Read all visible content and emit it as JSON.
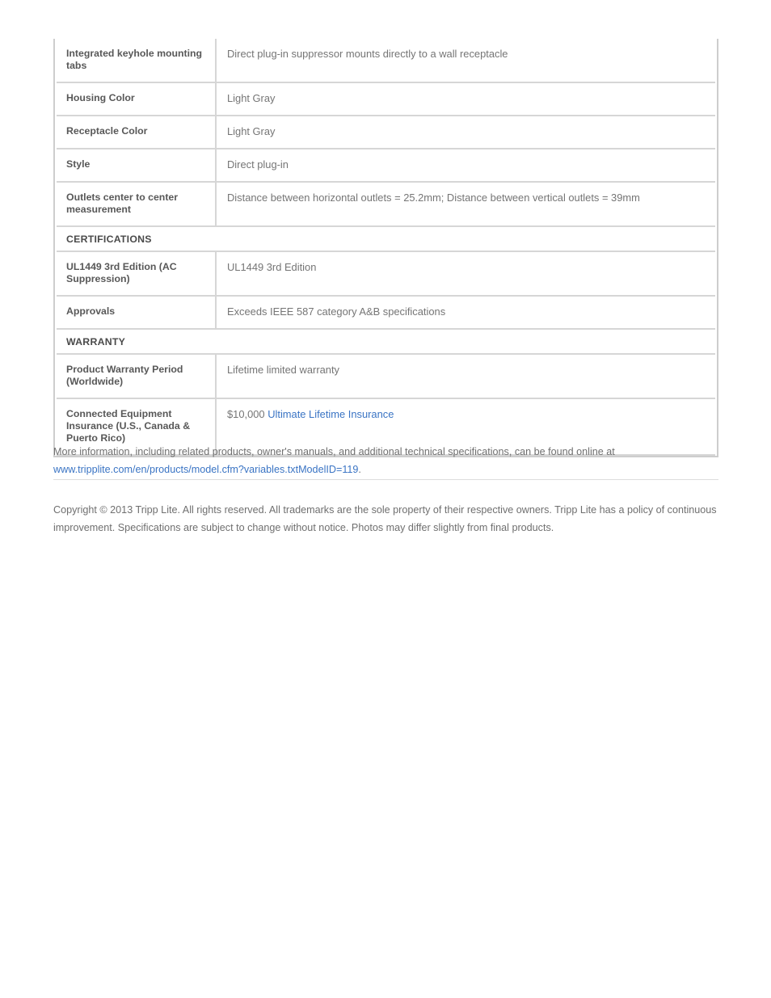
{
  "document": {
    "type": "product-specification-sheet",
    "brand": "Tripp Lite"
  },
  "spec_table": {
    "rows": [
      {
        "kind": "row",
        "label": "Integrated keyhole mounting tabs",
        "value": "Direct plug-in suppressor mounts directly to a wall receptacle"
      },
      {
        "kind": "row",
        "label": "Housing Color",
        "value": "Light Gray"
      },
      {
        "kind": "row",
        "label": "Receptacle Color",
        "value": "Light Gray"
      },
      {
        "kind": "row",
        "label": "Style",
        "value": "Direct plug-in"
      },
      {
        "kind": "row",
        "label": "Outlets center to center measurement",
        "value": "Distance between horizontal outlets = 25.2mm; Distance between vertical outlets = 39mm"
      },
      {
        "kind": "section",
        "label": "CERTIFICATIONS"
      },
      {
        "kind": "row",
        "label": "UL1449 3rd Edition (AC Suppression)",
        "value": "UL1449 3rd Edition"
      },
      {
        "kind": "row",
        "label": "Approvals",
        "value": "Exceeds IEEE 587 category A&B specifications"
      },
      {
        "kind": "section",
        "label": "WARRANTY"
      },
      {
        "kind": "row",
        "label": "Product Warranty Period (Worldwide)",
        "value": "Lifetime limited warranty"
      },
      {
        "kind": "row",
        "label": "Connected Equipment Insurance (U.S., Canada & Puerto Rico)",
        "value_prefix": "$10,000 ",
        "value_link": "Ultimate Lifetime Insurance"
      }
    ]
  },
  "more_info": {
    "lead_text": "More information, including related products, owner's manuals, and additional technical specifications, can be found online at ",
    "url_text": "www.tripplite.com/en/products/model.cfm?variables.txtModelID=119",
    "trailing_period": "."
  },
  "copyright": {
    "text": "Copyright © 2013 Tripp Lite. All rights reserved. All trademarks are the sole property of their respective owners. Tripp Lite has a policy of continuous improvement. Specifications are subject to change without notice. Photos may differ slightly from final products."
  },
  "colors": {
    "link": "#3a74c4",
    "label_text": "#585858",
    "value_text": "#757575",
    "section_text": "#4a4a4a",
    "border": "#d6d6d6",
    "outer_border": "#cdcdcd",
    "footer_text": "#6f6f6f"
  }
}
